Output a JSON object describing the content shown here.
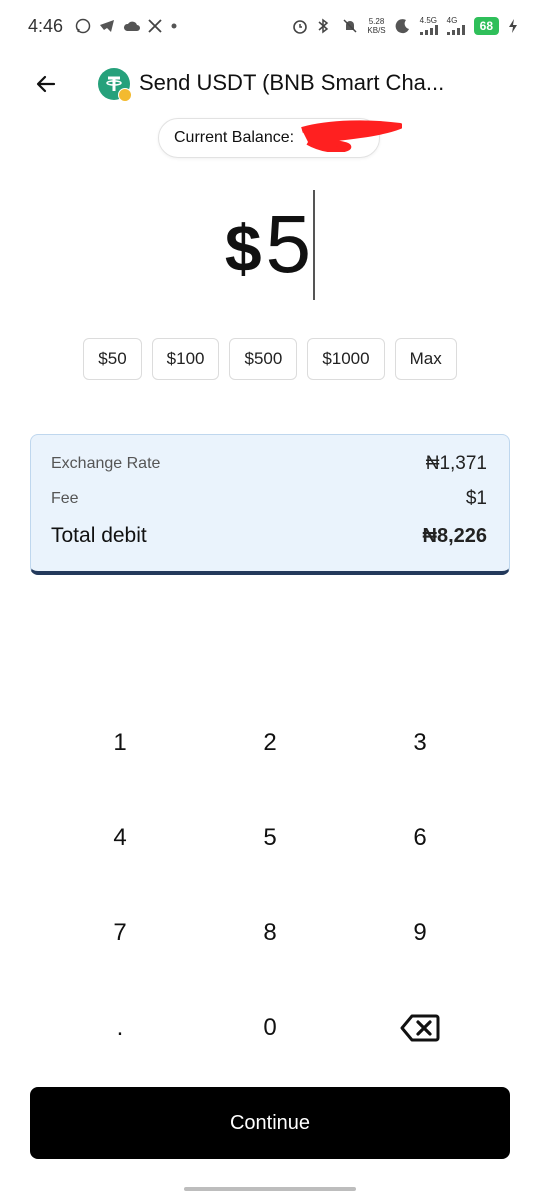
{
  "status_bar": {
    "time": "4:46",
    "net_speed_value": "5.28",
    "net_speed_unit": "KB/S",
    "signal1_label": "4.5G",
    "signal2_label": "4G",
    "battery": "68"
  },
  "header": {
    "title": "Send USDT (BNB Smart Cha..."
  },
  "balance": {
    "label": "Current Balance: "
  },
  "amount": {
    "currency": "$",
    "value": "5"
  },
  "quick_amounts": [
    "$50",
    "$100",
    "$500",
    "$1000",
    "Max"
  ],
  "summary": {
    "exchange_rate_label": "Exchange Rate",
    "exchange_rate_value": "₦1,371",
    "fee_label": "Fee",
    "fee_value": "$1",
    "total_label": "Total debit",
    "total_value": "₦8,226"
  },
  "keypad": [
    "1",
    "2",
    "3",
    "4",
    "5",
    "6",
    "7",
    "8",
    "9",
    ".",
    "0"
  ],
  "continue_label": "Continue",
  "colors": {
    "summary_bg": "#eaf3fc",
    "summary_border_bottom": "#23395b",
    "token_green": "#26a17b",
    "battery_green": "#2fbf5a"
  }
}
